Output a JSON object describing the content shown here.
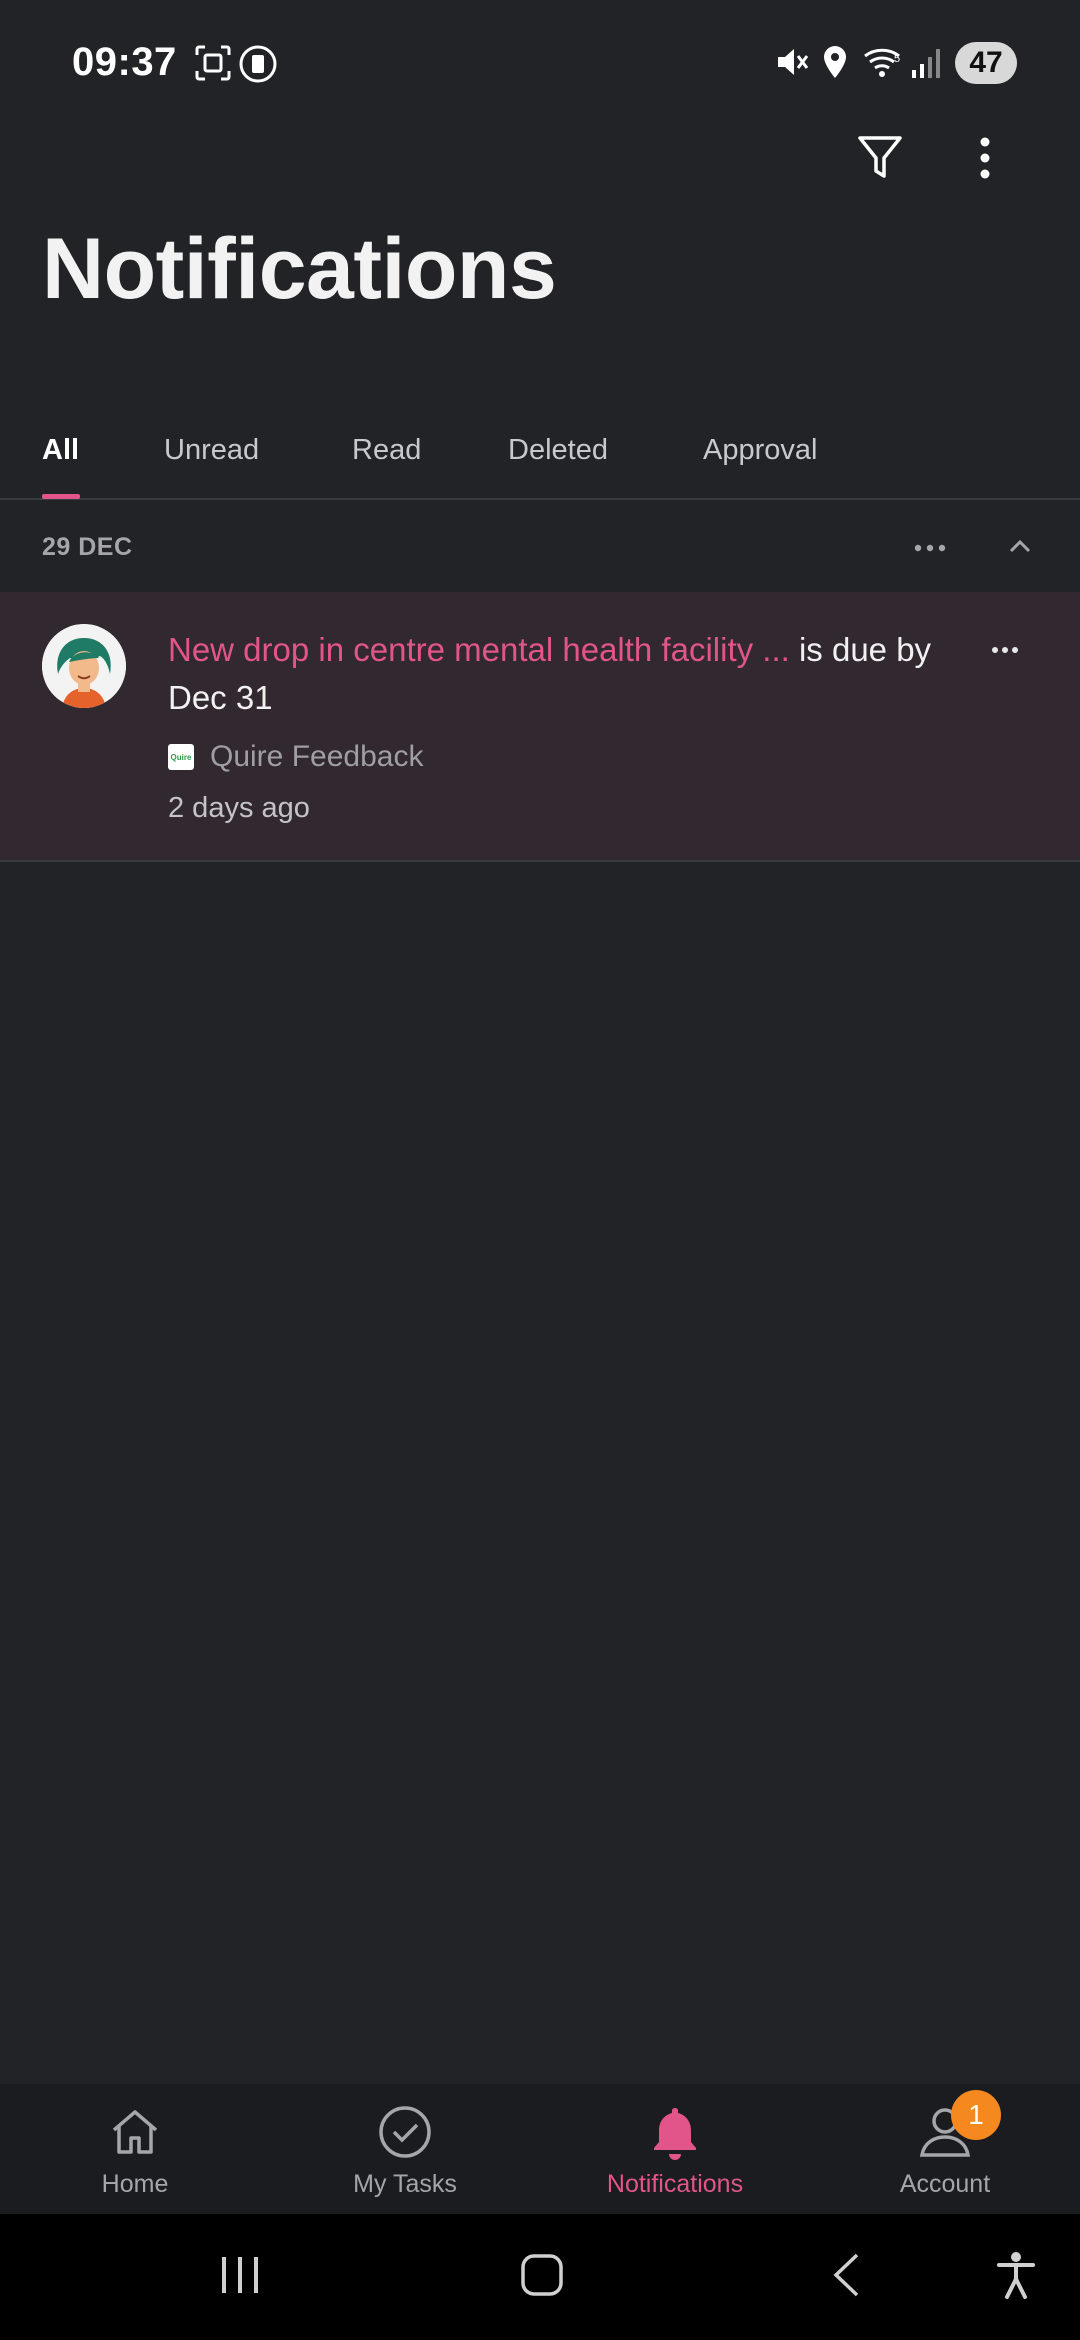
{
  "status_bar": {
    "time": "09:37",
    "battery": "47",
    "icons": [
      "screenshot-icon",
      "screen-record-icon",
      "mute-icon",
      "location-icon",
      "wifi-icon",
      "signal-icon"
    ]
  },
  "header": {
    "title": "Notifications",
    "actions": [
      "filter-icon",
      "more-vertical-icon"
    ]
  },
  "tabs": [
    {
      "label": "All",
      "active": true
    },
    {
      "label": "Unread",
      "active": false
    },
    {
      "label": "Read",
      "active": false
    },
    {
      "label": "Deleted",
      "active": false
    },
    {
      "label": "Approval",
      "active": false
    }
  ],
  "section": {
    "date": "29 DEC"
  },
  "notifications": [
    {
      "link_text": "New drop in centre mental health facility ...",
      "rest_text": " is due by Dec 31",
      "source": "Quire Feedback",
      "source_logo": "Quire",
      "time": "2 days ago"
    }
  ],
  "bottom_nav": [
    {
      "label": "Home",
      "icon": "home-icon",
      "active": false
    },
    {
      "label": "My Tasks",
      "icon": "check-circle-icon",
      "active": false
    },
    {
      "label": "Notifications",
      "icon": "bell-icon",
      "active": true
    },
    {
      "label": "Account",
      "icon": "user-icon",
      "active": false,
      "badge": "1"
    }
  ],
  "colors": {
    "background": "#222327",
    "accent": "#e2558b",
    "badge": "#f5891f",
    "highlight_row": "#322830"
  }
}
